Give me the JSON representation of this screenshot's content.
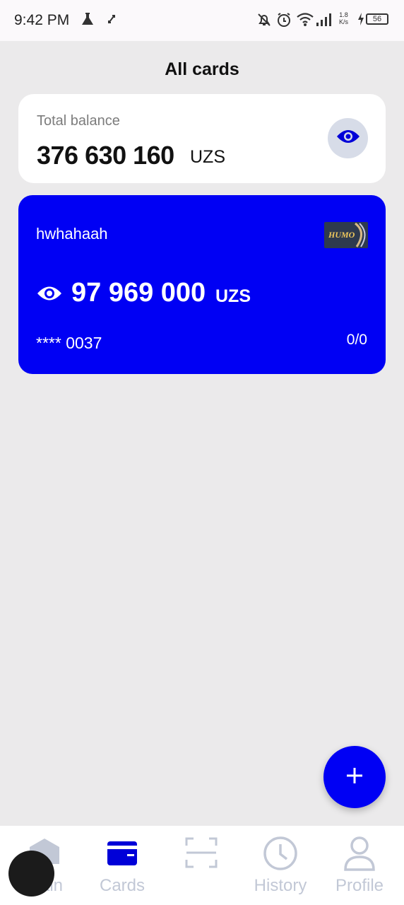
{
  "status_bar": {
    "time": "9:42 PM",
    "net_speed_value": "1.8",
    "net_speed_unit": "K/s",
    "battery": "56"
  },
  "page": {
    "title": "All cards"
  },
  "balance": {
    "label": "Total balance",
    "amount": "376 630 160",
    "currency": "UZS",
    "toggle_icon": "eye-icon"
  },
  "card": {
    "name": "hwhahaah",
    "brand": "HUMO",
    "amount": "97 969 000",
    "currency": "UZS",
    "number": "**** 0037",
    "count": "0/0",
    "color": "#0000f4"
  },
  "fab": {
    "icon": "plus-icon"
  },
  "nav": {
    "items": [
      {
        "label": "Main",
        "icon": "home-icon",
        "active": false
      },
      {
        "label": "Cards",
        "icon": "wallet-icon",
        "active": true
      },
      {
        "label": "",
        "icon": "scan-icon",
        "active": false
      },
      {
        "label": "History",
        "icon": "clock-icon",
        "active": false
      },
      {
        "label": "Profile",
        "icon": "user-icon",
        "active": false
      }
    ]
  },
  "colors": {
    "accent": "#0000f4",
    "background": "#ebeaeb",
    "inactive": "#c2c8d6"
  }
}
